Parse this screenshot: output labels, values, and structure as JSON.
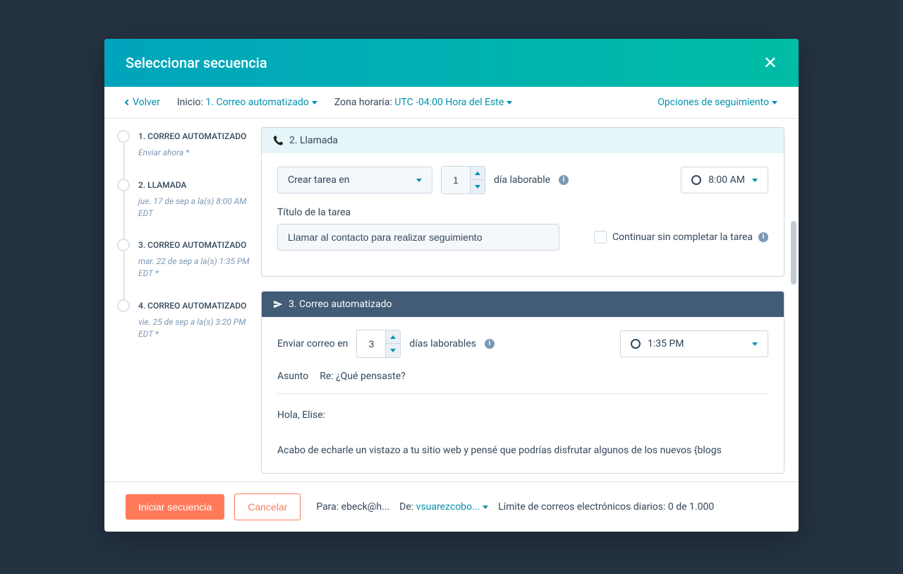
{
  "modal": {
    "title": "Seleccionar secuencia",
    "back": "Volver",
    "start_label": "Inicio:",
    "start_value": "1. Correo automatizado",
    "tz_label": "Zona horaria:",
    "tz_value": "UTC -04:00 Hora del Este",
    "followup": "Opciones de seguimiento"
  },
  "steps": [
    {
      "title": "1. CORREO AUTOMATIZADO",
      "sub": "Enviar ahora *"
    },
    {
      "title": "2. LLAMADA",
      "sub": "jue. 17 de sep a la(s) 8:00 AM EDT"
    },
    {
      "title": "3. CORREO AUTOMATIZADO",
      "sub": "mar. 22 de sep a la(s) 1:35 PM EDT *"
    },
    {
      "title": "4. CORREO AUTOMATIZADO",
      "sub": "vie. 25 de sep a la(s) 3:20 PM EDT *"
    }
  ],
  "card_call": {
    "header": "2. Llamada",
    "create_task": "Crear tarea en",
    "days": "1",
    "day_label": "día laborable",
    "time": "8:00 AM",
    "task_title_label": "Título de la tarea",
    "task_title": "Llamar al contacto para realizar seguimiento",
    "continue_label": "Continuar sin completar la tarea"
  },
  "card_email": {
    "header": "3. Correo automatizado",
    "send_label": "Enviar correo en",
    "days": "3",
    "day_label": "días laborables",
    "time": "1:35 PM",
    "subject_label": "Asunto",
    "subject": "Re: ¿Qué pensaste?",
    "body_greeting": "Hola, Elise:",
    "body_text": "Acabo de echarle un vistazo a tu sitio web y pensé que podrías disfrutar algunos de los nuevos {blogs"
  },
  "footer": {
    "start_btn": "Iniciar secuencia",
    "cancel_btn": "Cancelar",
    "para_label": "Para:",
    "para_value": "ebeck@h...",
    "de_label": "De:",
    "de_value": "vsuarezcobo...",
    "limit_label": "Límite de correos electrónicos diarios:",
    "limit_value": "0 de 1.000"
  }
}
